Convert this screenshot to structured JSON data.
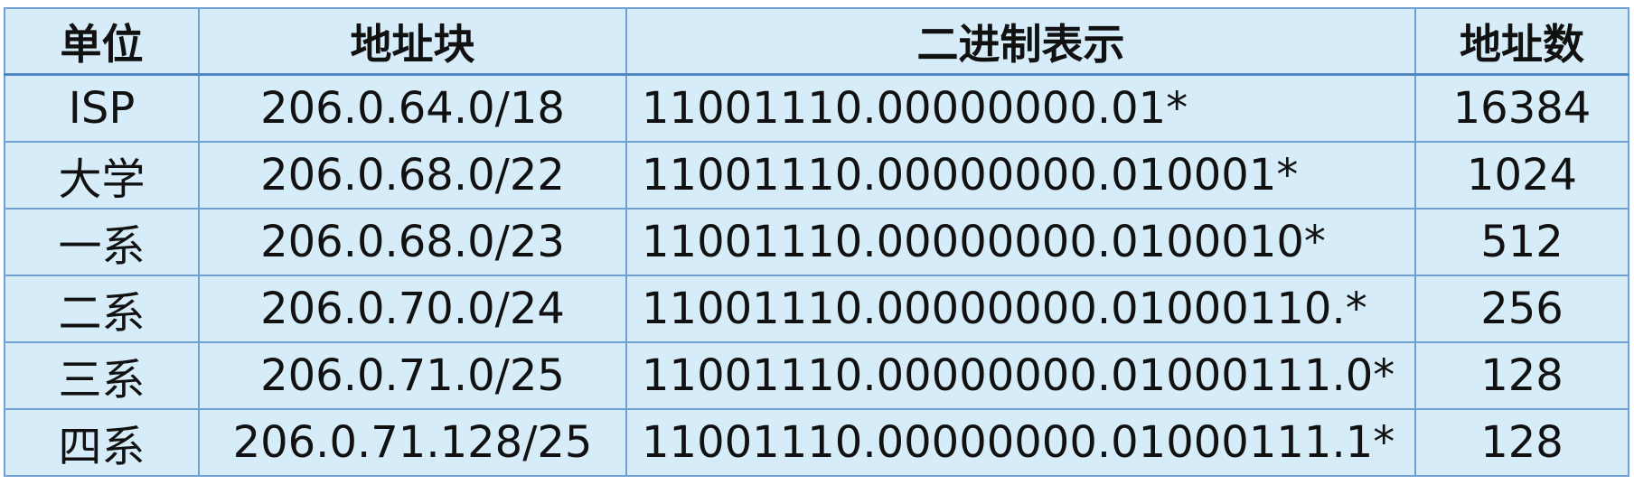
{
  "table": {
    "headers": {
      "unit": "单位",
      "block": "地址块",
      "binary": "二进制表示",
      "count": "地址数"
    },
    "rows": [
      {
        "unit": "ISP",
        "block": "206.0.64.0/18",
        "binary": "11001110.00000000.01*",
        "count": "16384"
      },
      {
        "unit": "大学",
        "block": "206.0.68.0/22",
        "binary": "11001110.00000000.010001*",
        "count": "1024"
      },
      {
        "unit": "一系",
        "block": "206.0.68.0/23",
        "binary": "11001110.00000000.0100010*",
        "count": "512"
      },
      {
        "unit": "二系",
        "block": "206.0.70.0/24",
        "binary": "11001110.00000000.01000110.*",
        "count": "256"
      },
      {
        "unit": "三系",
        "block": "206.0.71.0/25",
        "binary": "11001110.00000000.01000111.0*",
        "count": "128"
      },
      {
        "unit": "四系",
        "block": "206.0.71.128/25",
        "binary": "11001110.00000000.01000111.1*",
        "count": "128"
      }
    ]
  },
  "colors": {
    "cell_background": "#d6ecf8",
    "grid_line": "#6fa1d4",
    "text": "#111111"
  }
}
